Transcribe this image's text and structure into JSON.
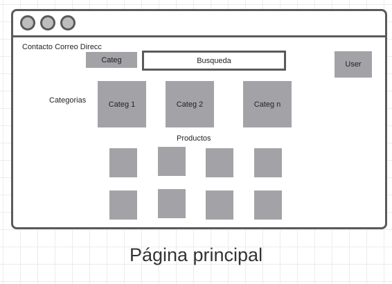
{
  "window": {
    "contact_text": "Contacto Correo Direcc",
    "category_button": "Categ",
    "search_text": "Busqueda",
    "user_button": "User",
    "categories_label": "Categorias",
    "categories": [
      "Categ 1",
      "Categ 2",
      "Categ n"
    ],
    "products_label": "Productos"
  },
  "caption": "Página principal",
  "colors": {
    "placeholder_fill": "#a3a3a7",
    "outline": "#5a5a5a"
  }
}
